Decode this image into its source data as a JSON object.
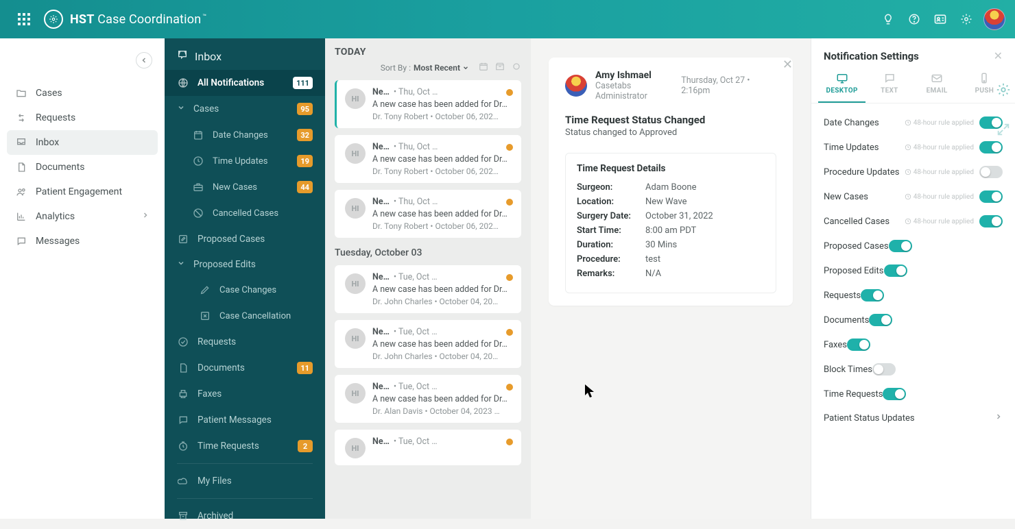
{
  "brand": {
    "bold": "HST",
    "rest": " Case Coordination"
  },
  "nav": {
    "items": [
      {
        "label": "Cases",
        "icon": "folder-icon"
      },
      {
        "label": "Requests",
        "icon": "arrows-icon"
      },
      {
        "label": "Inbox",
        "icon": "tray-icon",
        "active": true
      },
      {
        "label": "Documents",
        "icon": "doc-icon"
      },
      {
        "label": "Patient Engagement",
        "icon": "users-icon"
      },
      {
        "label": "Analytics",
        "icon": "chart-icon",
        "chevron": true
      },
      {
        "label": "Messages",
        "icon": "chat-icon"
      }
    ]
  },
  "inbox": {
    "title": "Inbox",
    "categories": [
      {
        "label": "All Notifications",
        "badge": "111",
        "badgeStyle": "white",
        "active": true,
        "icon": "globe-icon"
      },
      {
        "label": "Cases",
        "badge": "95",
        "badgeStyle": "orange",
        "section": true
      },
      {
        "label": "Date Changes",
        "badge": "32",
        "badgeStyle": "orange",
        "sub": true,
        "icon": "calendar-icon"
      },
      {
        "label": "Time Updates",
        "badge": "19",
        "badgeStyle": "orange",
        "sub": true,
        "icon": "clock-icon"
      },
      {
        "label": "New Cases",
        "badge": "44",
        "badgeStyle": "orange",
        "sub": true,
        "icon": "briefcase-icon"
      },
      {
        "label": "Cancelled Cases",
        "sub": true,
        "icon": "ban-icon"
      },
      {
        "label": "Proposed Cases",
        "icon": "pencil-square-icon"
      },
      {
        "label": "Proposed Edits",
        "section": true
      },
      {
        "label": "Case Changes",
        "subsub": true,
        "icon": "pencil-icon"
      },
      {
        "label": "Case Cancellation",
        "subsub": true,
        "icon": "cancel-icon"
      },
      {
        "label": "Requests",
        "icon": "check-circle-icon"
      },
      {
        "label": "Documents",
        "badge": "11",
        "badgeStyle": "orange",
        "icon": "file-icon"
      },
      {
        "label": "Faxes",
        "icon": "print-icon"
      },
      {
        "label": "Patient Messages",
        "icon": "chat-icon"
      },
      {
        "label": "Time Requests",
        "badge": "2",
        "badgeStyle": "orange",
        "icon": "time-icon"
      },
      {
        "divider": true
      },
      {
        "label": "My Files",
        "icon": "cloud-icon"
      },
      {
        "divider": true
      },
      {
        "label": "Archived",
        "icon": "archive-icon"
      }
    ]
  },
  "feed": {
    "todayLabel": "TODAY",
    "sortByLabel": "Sort By :",
    "sortValue": "Most Recent",
    "groups": [
      {
        "day": null,
        "items": [
          {
            "sender": "Ne…",
            "time": "• Thu, Oct …",
            "subject": "A new case has been added for Dr…",
            "meta": "Dr. Tony Robert • October 06, 202…",
            "avatar": "HI",
            "selected": true
          },
          {
            "sender": "Ne…",
            "time": "• Thu, Oct …",
            "subject": "A new case has been added for Dr…",
            "meta": "Dr. Tony Robert • October 06, 202…",
            "avatar": "HI"
          },
          {
            "sender": "Ne…",
            "time": "• Thu, Oct …",
            "subject": "A new case has been added for Dr…",
            "meta": "Dr. Tony Robert • October 06, 202…",
            "avatar": "HI"
          }
        ]
      },
      {
        "day": "Tuesday, October 03",
        "items": [
          {
            "sender": "Ne…",
            "time": "• Tue, Oct …",
            "subject": "A new case has been added for Dr…",
            "meta": "Dr. John Charles • October 04, 20…",
            "avatar": "HI"
          },
          {
            "sender": "Ne…",
            "time": "• Tue, Oct …",
            "subject": "A new case has been added for Dr…",
            "meta": "Dr. John Charles • October 04, 20…",
            "avatar": "HI"
          },
          {
            "sender": "Ne…",
            "time": "• Tue, Oct …",
            "subject": "A new case has been added for Dr…",
            "meta": "Dr. Alan Davis • October 04, 2023 …",
            "avatar": "HI"
          },
          {
            "sender": "Ne…",
            "time": "• Tue, Oct …",
            "subject": "",
            "meta": "",
            "avatar": "HI"
          }
        ]
      }
    ]
  },
  "detail": {
    "person": {
      "name": "Amy Ishmael",
      "role": "Casetabs Administrator"
    },
    "timestamp": "Thursday, Oct 27 • 2:16pm",
    "title": "Time Request Status Changed",
    "subtitle": "Status changed to Approved",
    "boxTitle": "Time Request Details",
    "fields": [
      {
        "k": "Surgeon:",
        "v": "Adam Boone"
      },
      {
        "k": "Location:",
        "v": "New Wave"
      },
      {
        "k": "Surgery Date:",
        "v": "October 31, 2022"
      },
      {
        "k": "Start Time:",
        "v": "8:00 am PDT"
      },
      {
        "k": "Duration:",
        "v": "30 Mins"
      },
      {
        "k": "Procedure:",
        "v": "test"
      },
      {
        "k": "Remarks:",
        "v": "N/A"
      }
    ]
  },
  "settings": {
    "title": "Notification Settings",
    "tabs": [
      {
        "label": "DESKTOP",
        "active": true
      },
      {
        "label": "TEXT"
      },
      {
        "label": "EMAIL"
      },
      {
        "label": "PUSH"
      }
    ],
    "ruleNote": "48-hour rule applied",
    "rows": [
      {
        "label": "Date Changes",
        "note": true,
        "on": true
      },
      {
        "label": "Time Updates",
        "note": true,
        "on": true
      },
      {
        "label": "Procedure Updates",
        "note": true,
        "on": false
      },
      {
        "label": "New Cases",
        "note": true,
        "on": true
      },
      {
        "label": "Cancelled Cases",
        "note": true,
        "on": true
      },
      {
        "label": "Proposed Cases",
        "on": true
      },
      {
        "label": "Proposed Edits",
        "on": true
      },
      {
        "label": "Requests",
        "on": true
      },
      {
        "label": "Documents",
        "on": true
      },
      {
        "label": "Faxes",
        "on": true
      },
      {
        "label": "Block Times",
        "on": false
      },
      {
        "label": "Time Requests",
        "on": true
      },
      {
        "label": "Patient Status Updates",
        "chevron": true
      }
    ]
  }
}
